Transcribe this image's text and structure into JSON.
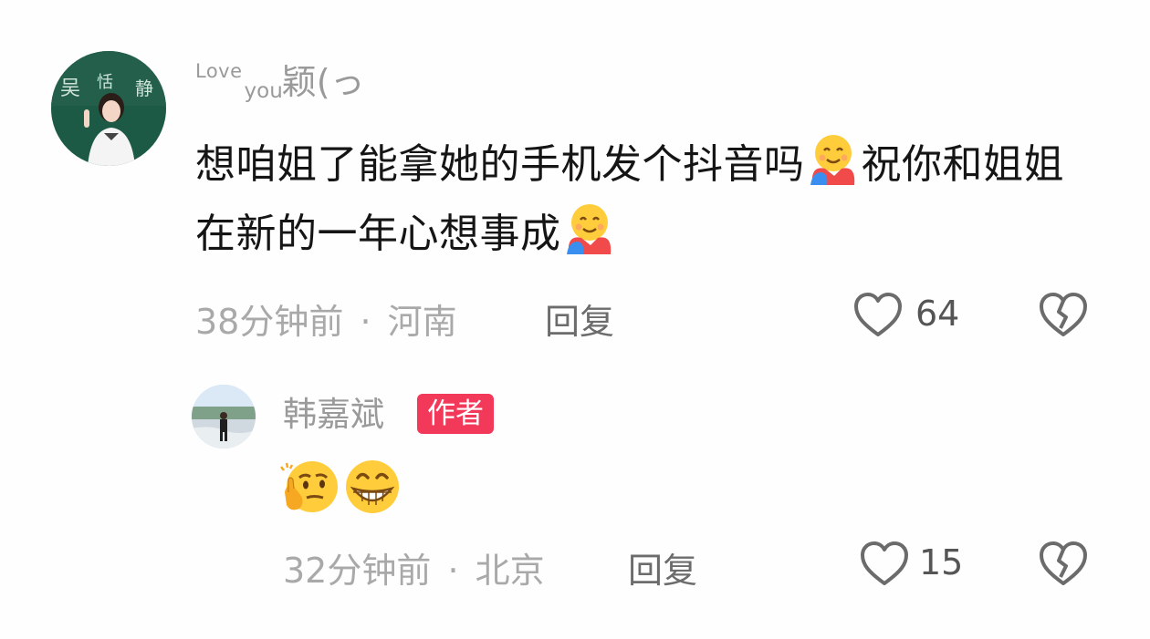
{
  "comment": {
    "username_love": "Love",
    "username_you": "you",
    "username_rest": "颖(っ",
    "text_part1": "想咱姐了能拿她的手机发个抖音吗",
    "text_part2": "祝你和姐姐在新的一年心想事成",
    "emoji_name": "smiling-face-with-open-hands-emoji",
    "time": "38分钟前",
    "separator": "·",
    "location": "河南",
    "reply_label": "回复",
    "like_count": "64"
  },
  "reply": {
    "username": "韩嘉斌",
    "badge": "作者",
    "emoji_1": "thinking-face-emoji",
    "emoji_2": "grinning-face-emoji",
    "time": "32分钟前",
    "separator": "·",
    "location": "北京",
    "reply_label": "回复",
    "like_count": "15"
  },
  "icons": {
    "like": "heart-outline-icon",
    "dislike": "broken-heart-icon"
  },
  "colors": {
    "badge": "#f2395a",
    "meta_text": "#a9a9a9",
    "username": "#9a9a9a"
  }
}
